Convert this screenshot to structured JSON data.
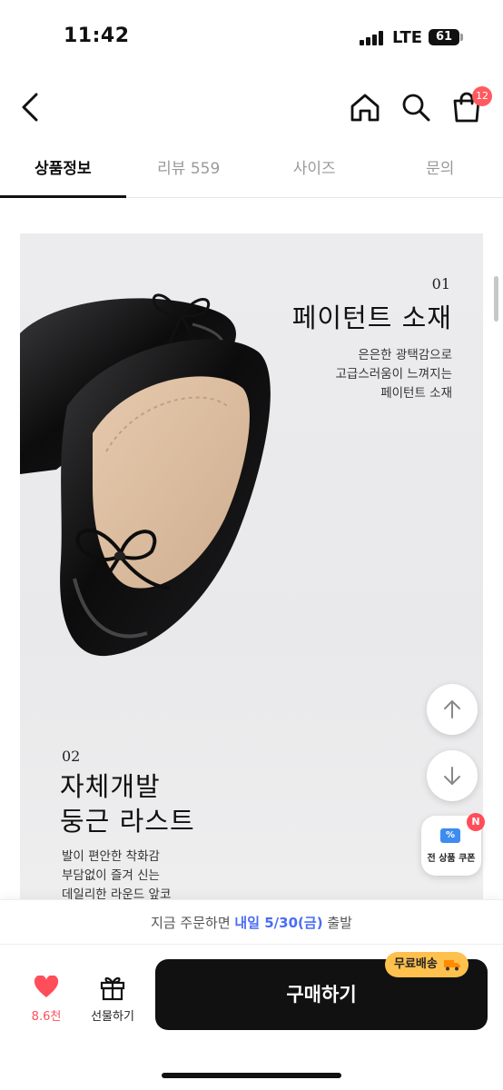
{
  "status_bar": {
    "time": "11:42",
    "network": "LTE",
    "battery": "61"
  },
  "header": {
    "cart_count": "12"
  },
  "tabs": [
    {
      "label": "상품정보",
      "active": true
    },
    {
      "label": "리뷰 559",
      "active": false
    },
    {
      "label": "사이즈",
      "active": false
    },
    {
      "label": "문의",
      "active": false
    }
  ],
  "detail": {
    "section1": {
      "number": "01",
      "title": "페이턴트 소재",
      "desc": [
        "은은한 광택감으로",
        "고급스러움이 느껴지는",
        "페이턴트 소재"
      ]
    },
    "section2": {
      "number": "02",
      "title": [
        "자체개발",
        "둥근 라스트"
      ],
      "desc": [
        "발이 편안한 착화감",
        "부담없이 즐겨 신는",
        "데일리한 라운드 앞코"
      ]
    }
  },
  "floating": {
    "coupon_label": "전 상품 쿠폰",
    "coupon_badge": "N"
  },
  "notice": {
    "prefix": "지금 주문하면",
    "highlight": "내일 5/30(금)",
    "suffix": "출발"
  },
  "bottom_bar": {
    "like_count": "8.6천",
    "gift_label": "선물하기",
    "buy_label": "구매하기",
    "free_shipping": "무료배송"
  },
  "colors": {
    "accent_blue": "#4a6cf7",
    "badge_red": "#ff4d5a",
    "free_shipping_yellow": "#ffc14d",
    "buy_button": "#111111"
  }
}
